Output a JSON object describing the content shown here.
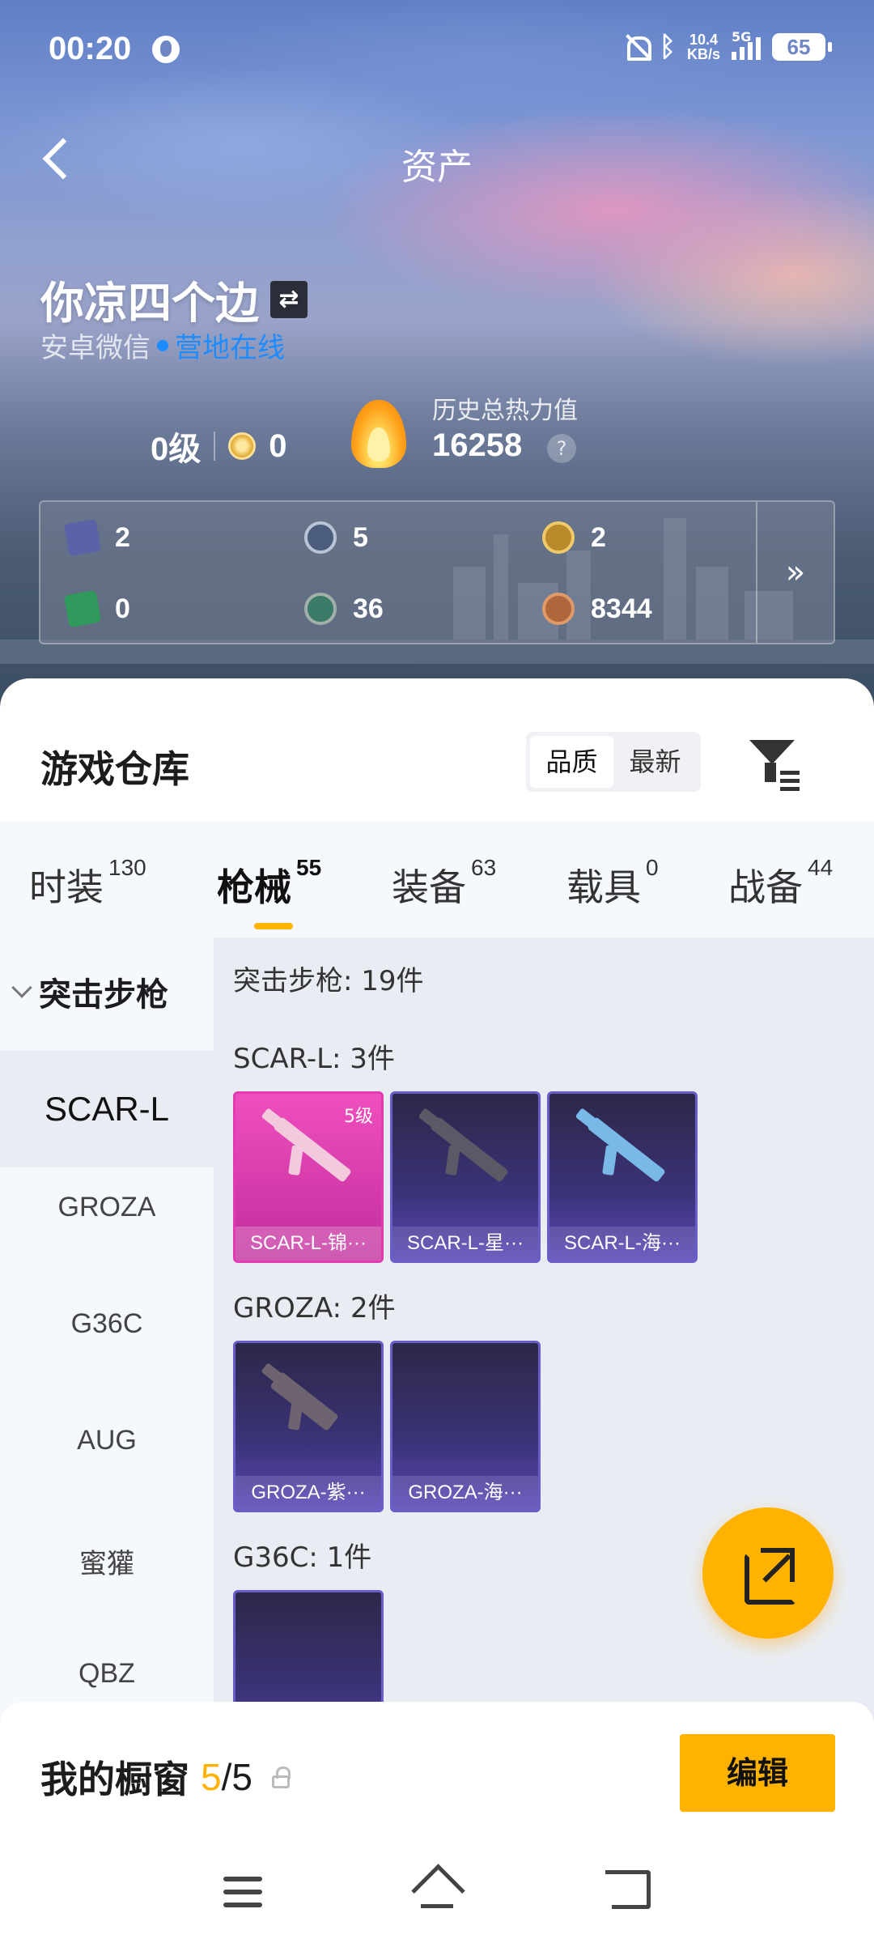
{
  "status": {
    "time": "00:20",
    "network_speed": "10.4",
    "network_unit": "KB/s",
    "signal_tag": "5G",
    "battery": "65"
  },
  "header": {
    "title": "资产"
  },
  "profile": {
    "name": "你凉四个边",
    "swap_icon": "⇄",
    "platform": "安卓微信",
    "online_status": "营地在线",
    "level": "0级",
    "medal_count": "0",
    "heat_label": "历史总热力值",
    "heat_value": "16258",
    "help": "?"
  },
  "stats": [
    {
      "icon": "card-purple-icon",
      "value": "2",
      "color": "#5a62a8"
    },
    {
      "icon": "coin-blue-icon",
      "value": "5",
      "color": "#4b5d7a"
    },
    {
      "icon": "coin-gold-icon",
      "value": "2",
      "color": "#b88a2a"
    },
    {
      "icon": "card-green-icon",
      "value": "0",
      "color": "#2f9a5c"
    },
    {
      "icon": "orb-green-icon",
      "value": "36",
      "color": "#3c7a6a"
    },
    {
      "icon": "coin-copper-icon",
      "value": "8344",
      "color": "#b0663a"
    }
  ],
  "stats_more": "»",
  "warehouse": {
    "title": "游戏仓库",
    "sort": [
      "品质",
      "最新"
    ],
    "tabs": [
      {
        "label": "时装",
        "count": "130"
      },
      {
        "label": "枪械",
        "count": "55"
      },
      {
        "label": "装备",
        "count": "63"
      },
      {
        "label": "载具",
        "count": "0"
      },
      {
        "label": "战备",
        "count": "44"
      }
    ],
    "category": "突击步枪",
    "side_items": [
      "SCAR-L",
      "GROZA",
      "G36C",
      "AUG",
      "蜜獾",
      "QBZ"
    ],
    "summary": "突击步枪: 19件",
    "groups": [
      {
        "heading": "SCAR-L: 3件",
        "items": [
          {
            "label": "SCAR-L-锦···",
            "badge": "5级"
          },
          {
            "label": "SCAR-L-星···"
          },
          {
            "label": "SCAR-L-海···"
          }
        ]
      },
      {
        "heading": "GROZA: 2件",
        "items": [
          {
            "label": "GROZA-紫···"
          },
          {
            "label": "GROZA-海···"
          }
        ]
      },
      {
        "heading": "G36C: 1件",
        "items": [
          {
            "label": ""
          }
        ]
      }
    ]
  },
  "showcase": {
    "label": "我的橱窗",
    "current": "5",
    "total": "/5",
    "edit": "编辑"
  },
  "colors": {
    "accent": "#ffb300",
    "online": "#1d8cff",
    "rare_pink": "#e23ab0",
    "epic_purple": "#6a5cc9"
  }
}
